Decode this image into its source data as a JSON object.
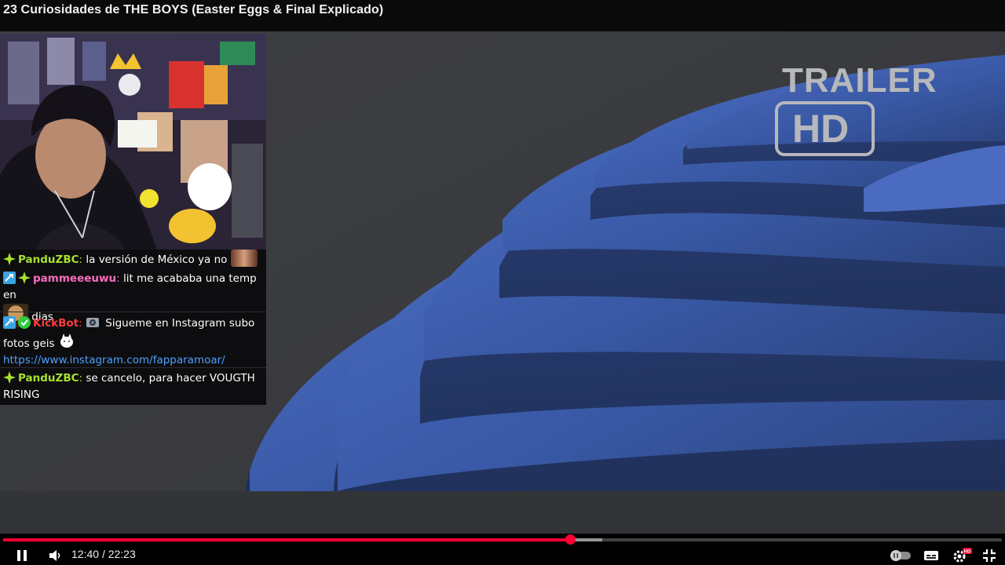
{
  "video": {
    "title": "23 Curiosidades de THE BOYS (Easter Eggs & Final Explicado)"
  },
  "overlay": {
    "trailer_label": "TRAILER",
    "hd_label": "HD"
  },
  "chat": {
    "messages": [
      {
        "user": "PanduZBC",
        "user_color": "#a6e22e",
        "text": "la versión de México ya no"
      },
      {
        "user": "pammeeeuwu",
        "user_color": "#ff6bc1",
        "text": "lit me acababa una temp en",
        "text2": "dias"
      },
      {
        "user": "KickBot",
        "user_color": "#ff3b3b",
        "text": "Sigueme en Instagram subo",
        "text2": "fotos geis",
        "link": "https://www.instagram.com/fapparamoar/"
      },
      {
        "user": "PanduZBC",
        "user_color": "#a6e22e",
        "text": "se cancelo, para hacer VOUGTH",
        "text2": "RISING"
      }
    ]
  },
  "player": {
    "current_time": "12:40",
    "separator": "/",
    "duration": "22:23",
    "played_fraction": 0.568,
    "buffered_fraction": 0.6
  },
  "icons": {
    "pause": "pause-icon",
    "volume": "volume-icon",
    "autoplay": "autoplay-toggle-icon",
    "subtitles": "subtitles-icon",
    "settings": "settings-gear-icon",
    "hd_badge": "HD",
    "exit_fullscreen": "exit-fullscreen-icon"
  },
  "colors": {
    "progress": "#ff0033",
    "accent_blue": "#3b5fae"
  }
}
